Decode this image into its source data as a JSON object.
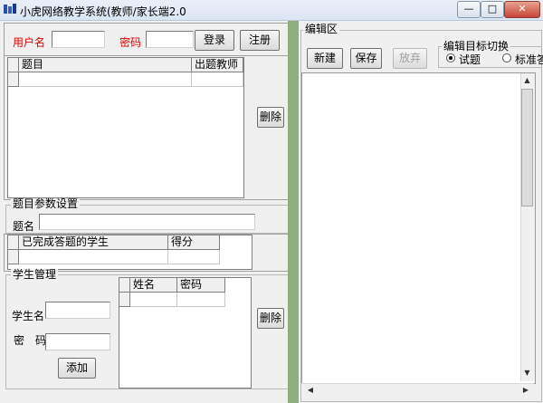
{
  "window": {
    "title": "小虎网络教学系统(教师/家长端2.0",
    "min_label": "—",
    "max_label": "□",
    "close_label": "✕"
  },
  "login": {
    "username_label": "用户名",
    "username_value": "",
    "password_label": "密码",
    "password_value": "",
    "login_button": "登录",
    "register_button": "注册"
  },
  "question_table": {
    "columns": [
      "题目",
      "出题教师"
    ],
    "rows": [
      [
        "",
        ""
      ]
    ],
    "delete_button": "删除"
  },
  "question_params": {
    "group_label": "题目参数设置",
    "name_label": "题名",
    "name_value": "",
    "columns": [
      "已完成答题的学生",
      "得分"
    ],
    "rows": [
      [
        "",
        ""
      ]
    ]
  },
  "student_mgmt": {
    "group_label": "学生管理",
    "name_label": "学生名",
    "name_value": "",
    "password_label": "密　码",
    "password_value": "",
    "add_button": "添加",
    "columns": [
      "姓名",
      "密码"
    ],
    "rows": [
      [
        "",
        ""
      ]
    ],
    "delete_button": "删除"
  },
  "editor": {
    "group_label": "编辑区",
    "new_button": "新建",
    "save_button": "保存",
    "discard_button": "放弃",
    "target_group_label": "编辑目标切换",
    "target_options": [
      "试题",
      "标准答"
    ],
    "target_selected": "试题",
    "content": ""
  },
  "colors": {
    "splitter": "#8fae7e",
    "required_label": "#e00000"
  }
}
